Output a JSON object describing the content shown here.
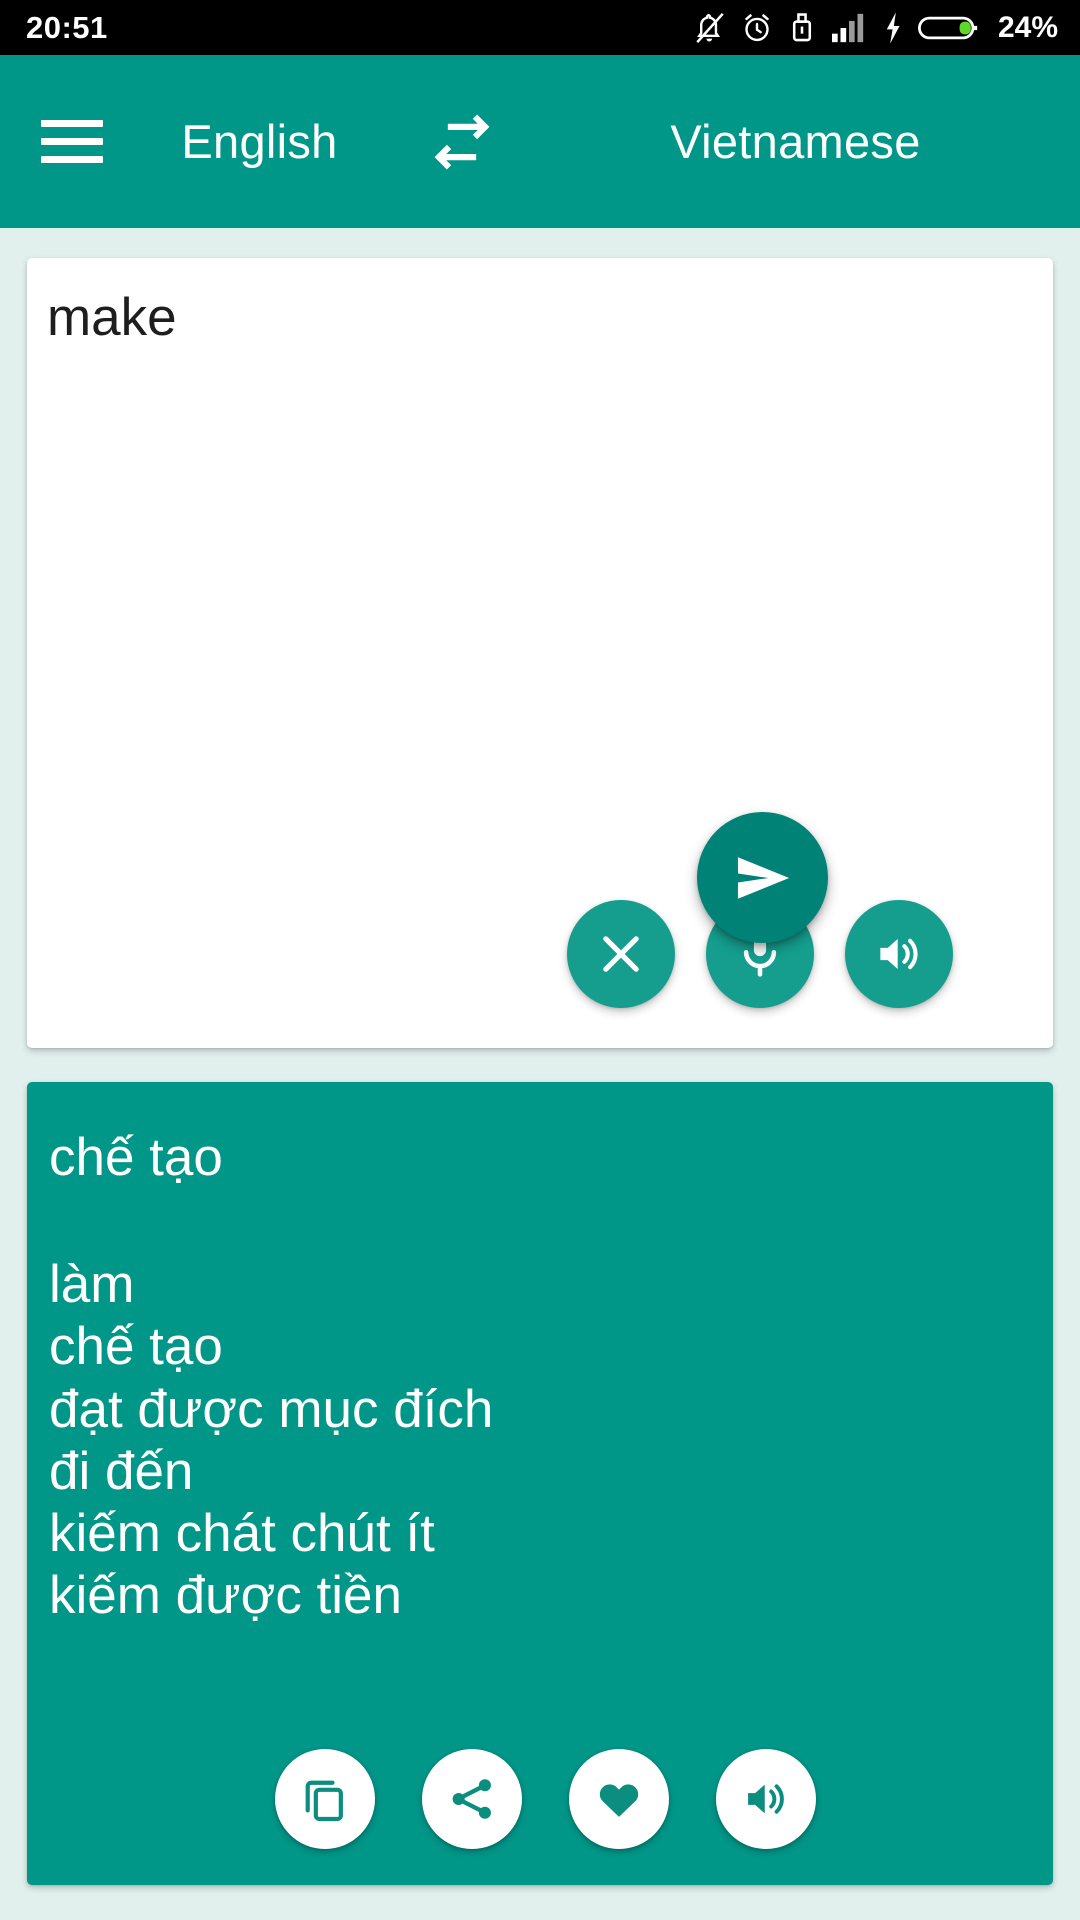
{
  "status_bar": {
    "clock": "20:51",
    "battery_percent": "24%",
    "icons": [
      "notifications-off-icon",
      "alarm-clock-icon",
      "usb-lock-icon",
      "signal-bars-icon",
      "charging-bolt-icon",
      "battery-icon"
    ],
    "colors": {
      "background": "#000000",
      "text": "#ffffff",
      "battery_fill": "#5ed62a"
    }
  },
  "app_bar": {
    "menu_icon": "hamburger-menu-icon",
    "source_language": "English",
    "swap_icon": "swap-languages-icon",
    "target_language": "Vietnamese",
    "color": "#009688"
  },
  "input_card": {
    "text": "make",
    "actions": [
      {
        "name": "clear-button",
        "icon": "close-x-icon",
        "label": "Clear"
      },
      {
        "name": "voice-input-button",
        "icon": "microphone-icon",
        "label": "Speak"
      },
      {
        "name": "speak-source-button",
        "icon": "speaker-icon",
        "label": "Listen"
      }
    ]
  },
  "send_button": {
    "icon": "send-arrow-icon",
    "label": "Translate",
    "color": "#008276"
  },
  "result_card": {
    "main_translation": "chế tạo",
    "alternates": [
      "làm",
      "chế tạo",
      "đạt được mục đích",
      "đi đến",
      "kiếm chát chút ít",
      "kiếm được tiền"
    ],
    "actions": [
      {
        "name": "copy-button",
        "icon": "copy-icon",
        "label": "Copy"
      },
      {
        "name": "share-button",
        "icon": "share-icon",
        "label": "Share"
      },
      {
        "name": "favorite-button",
        "icon": "heart-icon",
        "label": "Favorite"
      },
      {
        "name": "speak-result-button",
        "icon": "speaker-icon",
        "label": "Listen"
      }
    ],
    "color": "#009688"
  },
  "page": {
    "background": "#E1F0ED"
  }
}
